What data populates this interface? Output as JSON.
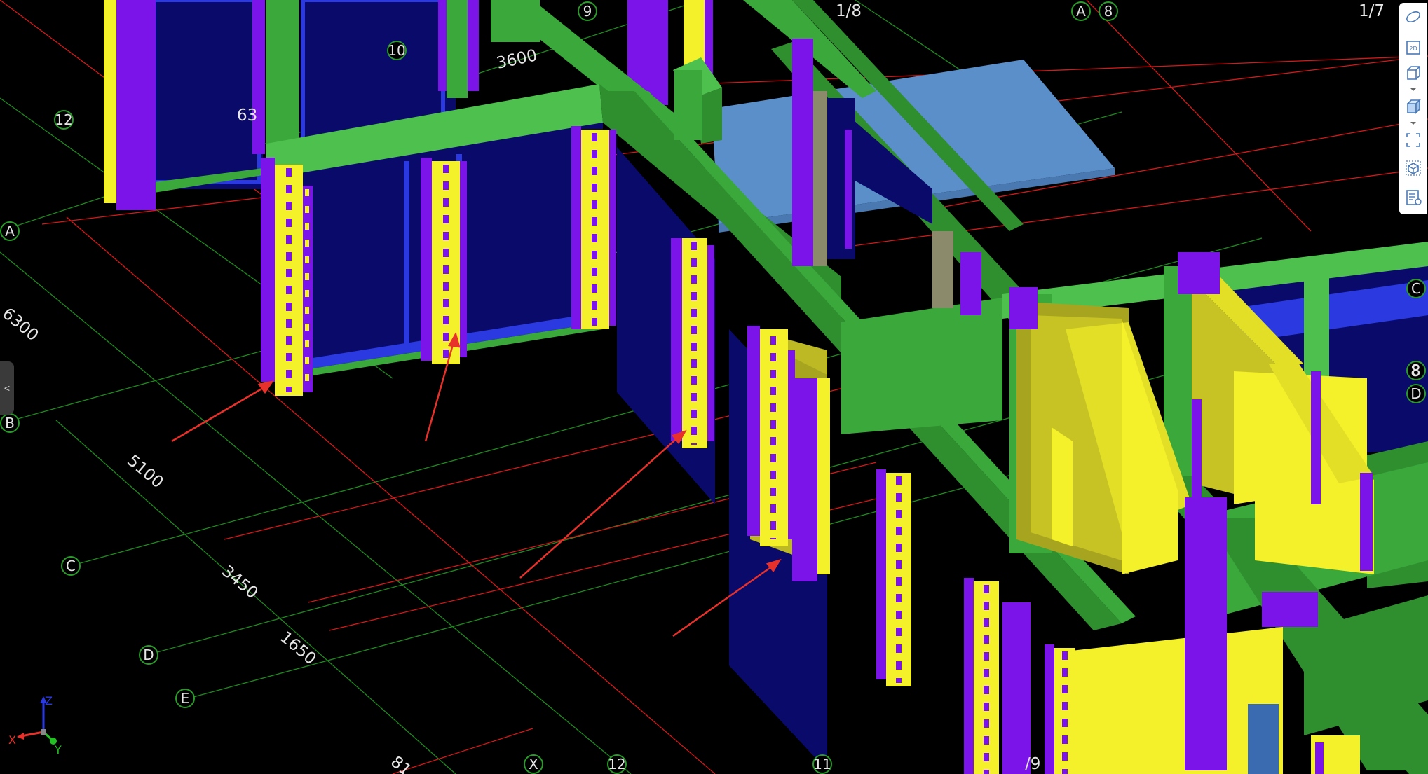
{
  "grid_labels": {
    "bubbles": [
      "12",
      "A",
      "B",
      "C",
      "D",
      "E",
      "X",
      "12",
      "11",
      "10",
      "9",
      "A",
      "8",
      "C",
      "8",
      "D"
    ],
    "dimensions": [
      "6300",
      "5100",
      "3450",
      "1650",
      "3600",
      "63",
      "1/8",
      "1/7",
      "8",
      "81",
      "/9"
    ]
  },
  "axis_triad": {
    "x": "X",
    "y": "Y",
    "z": "Z"
  },
  "toolbar": {
    "items": [
      "orbit-icon",
      "2d-view-icon",
      "3d-box-icon",
      "3d-solid-icon",
      "fit-view-icon",
      "section-box-icon",
      "properties-icon"
    ],
    "btn_2d_label": "2D"
  },
  "left_tab": {
    "label": "<"
  },
  "colors": {
    "background": "#000000",
    "beam": "#3aa83a",
    "column_purple": "#7a14e8",
    "column_yellow": "#f4f02a",
    "glass": "#0a0a6a",
    "slab": "#5b8fc9",
    "grid_red": "#d81818",
    "grid_green": "#1f8a1f",
    "arrow": "#e8312a"
  }
}
